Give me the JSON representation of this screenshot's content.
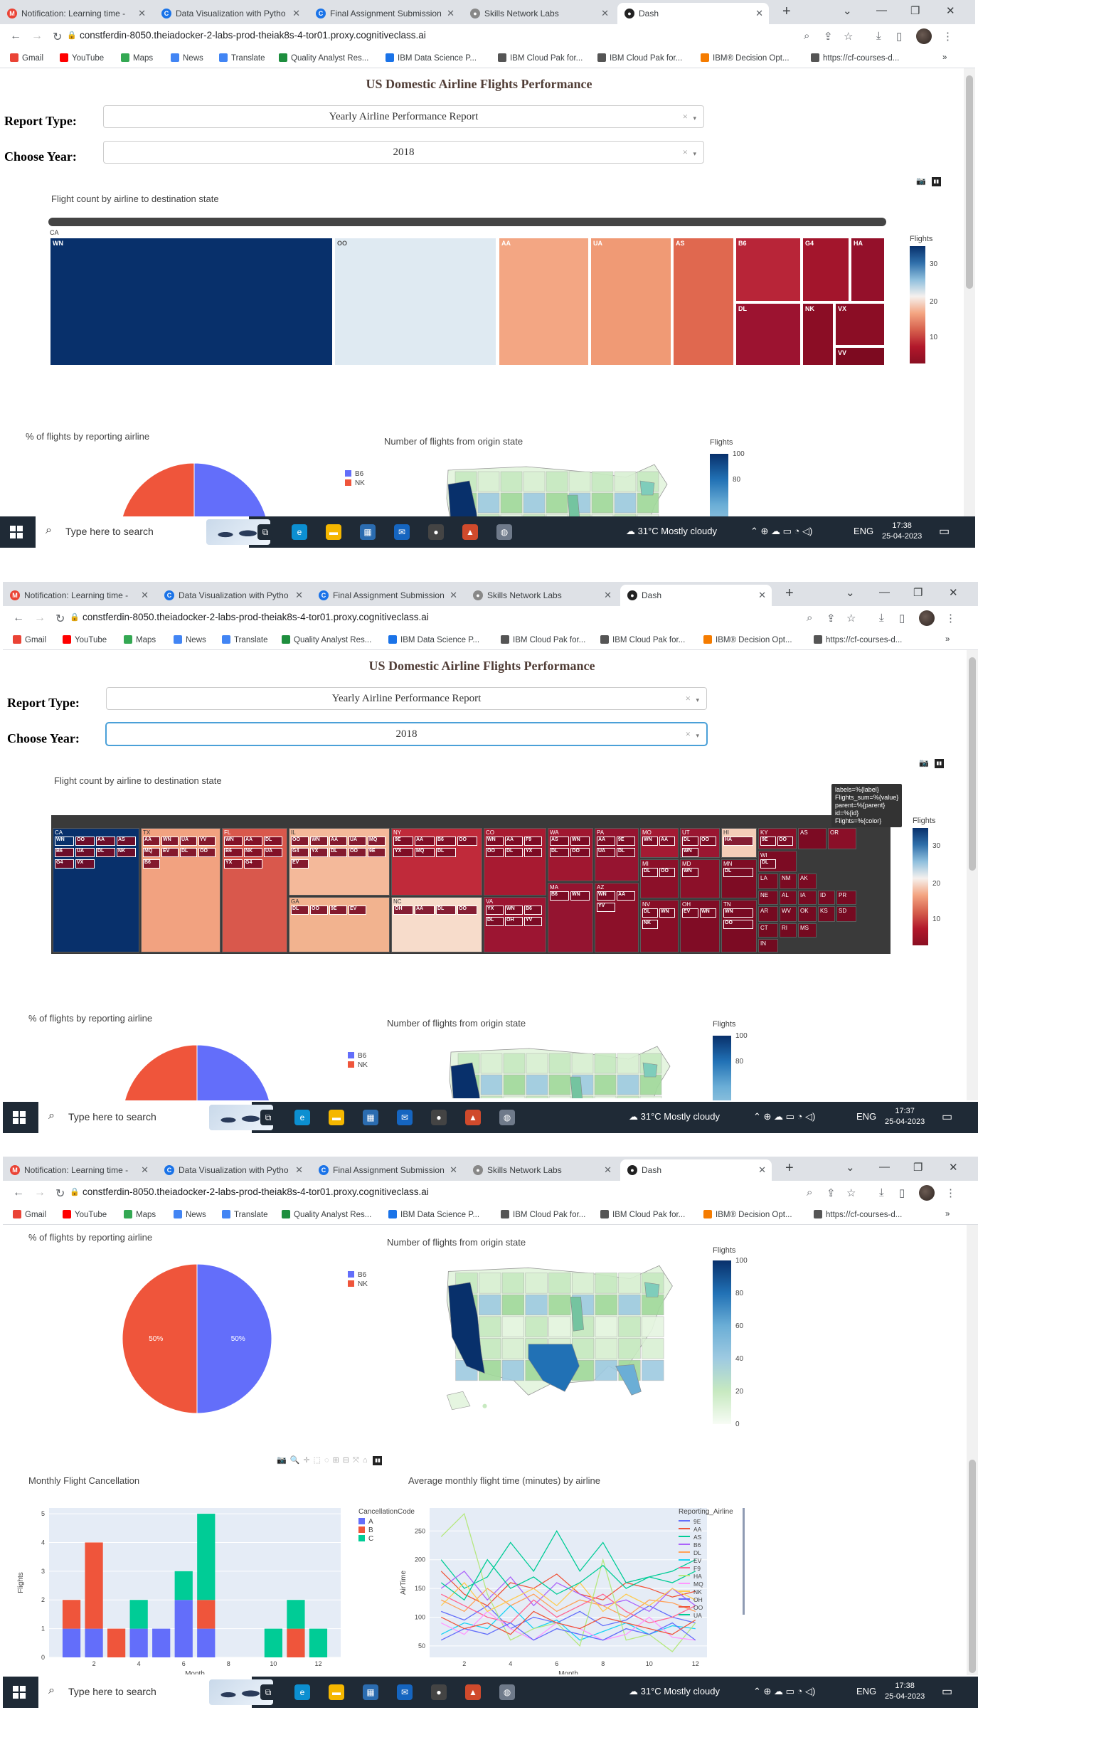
{
  "browser": {
    "tabs": [
      {
        "label": "Notification: Learning time - ",
        "favicon": "gmail-icon"
      },
      {
        "label": "Data Visualization with Pytho",
        "favicon": "coursera-icon"
      },
      {
        "label": "Final Assignment Submission",
        "favicon": "coursera-icon"
      },
      {
        "label": "Skills Network Labs",
        "favicon": "skills-network-icon"
      },
      {
        "label": "Dash",
        "favicon": "dash-icon"
      }
    ],
    "new_tab": "+",
    "url": "constferdin-8050.theiadocker-2-labs-prod-theiak8s-4-tor01.proxy.cognitiveclass.ai",
    "bookmarks": [
      "Gmail",
      "YouTube",
      "Maps",
      "News",
      "Translate",
      "Quality Analyst Res...",
      "IBM Data Science P...",
      "IBM Cloud Pak for...",
      "IBM Cloud Pak for...",
      "IBM® Decision Opt...",
      "https://cf-courses-d..."
    ],
    "more": "»"
  },
  "dashboard": {
    "title": "US Domestic Airline Flights Performance",
    "report_type_label": "Report Type:",
    "report_type_value": "Yearly Airline Performance Report",
    "year_label": "Choose Year:",
    "year_value": "2018",
    "clear": "×",
    "caret": "▾"
  },
  "treemap": {
    "title": "Flight count by airline to destination state",
    "colorbar_title": "Flights",
    "colorbar_ticks": [
      "30",
      "20",
      "10"
    ],
    "zoomed_parent": "CA",
    "zoomed_cells": [
      "WN",
      "OO",
      "AA",
      "UA",
      "AS",
      "B6",
      "G4",
      "HA",
      "DL",
      "NK",
      "VX",
      "VV"
    ],
    "states": [
      "CA",
      "TX",
      "FL",
      "IL",
      "NY",
      "CO",
      "WA",
      "PA",
      "MO",
      "UT",
      "HI",
      "KY",
      "GA",
      "NC",
      "VA",
      "MA",
      "AZ",
      "MI",
      "MD",
      "MN",
      "NV",
      "OH",
      "TN",
      "WI",
      "LA",
      "NM",
      "AK",
      "NE",
      "AL",
      "IA",
      "ID",
      "PR",
      "AR",
      "WV",
      "OK",
      "KS",
      "SD",
      "CT",
      "RI",
      "MS",
      "IN",
      "AS",
      "OR"
    ],
    "sub_labels": {
      "CA": [
        "WN",
        "OO",
        "AA",
        "AS",
        "B6",
        "UA",
        "DL",
        "NK",
        "G4",
        "VX"
      ],
      "TX": [
        "AA",
        "WN",
        "UA",
        "YV",
        "MQ",
        "EV",
        "DL",
        "OO",
        "B6"
      ],
      "FL": [
        "WN",
        "AA",
        "DL",
        "B6",
        "NK",
        "UA",
        "YX",
        "G4"
      ],
      "IL": [
        "OO",
        "WN",
        "AA",
        "UA",
        "MQ",
        "G4",
        "YX",
        "DL",
        "OO",
        "9E",
        "EV"
      ],
      "NY": [
        "9E",
        "AA",
        "B6",
        "OO",
        "YX",
        "MQ",
        "DL"
      ],
      "CO": [
        "WN",
        "AA",
        "F9",
        "OO",
        "DL",
        "YX"
      ],
      "WA": [
        "AS",
        "WN",
        "DL",
        "OO"
      ],
      "PA": [
        "AA",
        "9E",
        "UA",
        "DL"
      ],
      "MO": [
        "WN",
        "AA"
      ],
      "UT": [
        "DL",
        "OO",
        "WN"
      ],
      "HI": [
        "HA"
      ],
      "KY": [
        "9E",
        "OO",
        "DL"
      ],
      "GA": [
        "DL",
        "OO",
        "9E",
        "EV"
      ],
      "NC": [
        "OH",
        "AA",
        "DL",
        "OO"
      ],
      "VA": [
        "YX",
        "WN",
        "B6",
        "DL",
        "OH",
        "YV"
      ],
      "MA": [
        "B6",
        "WN"
      ],
      "AZ": [
        "WN",
        "AA",
        "YV"
      ],
      "MI": [
        "DL",
        "OO"
      ],
      "MD": [
        "WN"
      ],
      "MN": [
        "DL"
      ],
      "NV": [
        "DL",
        "WN",
        "NK"
      ],
      "OH": [
        "EV",
        "WN"
      ],
      "TN": [
        "WN",
        "OO"
      ],
      "WI": [
        "DL"
      ]
    }
  },
  "tooltip": {
    "lines": [
      "labels=%{label}",
      "Flights_sum=%{value}",
      "parent=%{parent}",
      "id=%{id}",
      "Flights=%{color}"
    ]
  },
  "pie": {
    "title": "% of flights by reporting airline",
    "legend": [
      {
        "label": "B6",
        "color": "#636efa"
      },
      {
        "label": "NK",
        "color": "#ef553b"
      }
    ],
    "slices": [
      {
        "label": "B6",
        "value": 50,
        "text": "50%"
      },
      {
        "label": "NK",
        "value": 50,
        "text": "50%"
      }
    ]
  },
  "map": {
    "title": "Number of flights from origin state",
    "colorbar_title": "Flights",
    "colorbar_ticks": [
      "100",
      "80",
      "60",
      "40",
      "20",
      "0"
    ]
  },
  "cancellation": {
    "title": "Monthly Flight Cancellation",
    "ylabel": "Flights",
    "xlabel": "Month",
    "legend_title": "CancellationCode",
    "legend": [
      {
        "label": "A",
        "color": "#636efa"
      },
      {
        "label": "B",
        "color": "#ef553b"
      },
      {
        "label": "C",
        "color": "#00cc96"
      }
    ],
    "y_ticks": [
      "0",
      "1",
      "2",
      "3",
      "4",
      "5"
    ],
    "x_ticks": [
      "2",
      "4",
      "6",
      "8",
      "10",
      "12"
    ]
  },
  "airtime": {
    "title": "Average monthly flight time (minutes) by airline",
    "ylabel": "AirTime",
    "xlabel": "Month",
    "legend_title": "Reporting_Airline",
    "y_ticks": [
      "50",
      "100",
      "150",
      "200",
      "250"
    ],
    "x_ticks": [
      "2",
      "4",
      "6",
      "8",
      "10",
      "12"
    ]
  },
  "taskbar": {
    "search_placeholder": "Type here to search",
    "weather": "31°C  Mostly cloudy",
    "lang": "ENG",
    "date": "25-04-2023",
    "times": [
      "17:38",
      "17:37",
      "17:38"
    ]
  },
  "chart_data": [
    {
      "type": "pie",
      "title": "% of flights by reporting airline",
      "labels": [
        "B6",
        "NK"
      ],
      "values": [
        50,
        50
      ],
      "colors": [
        "#636efa",
        "#ef553b"
      ]
    },
    {
      "type": "bar",
      "title": "Monthly Flight Cancellation",
      "xlabel": "Month",
      "ylabel": "Flights",
      "barmode": "stack",
      "x": [
        1,
        2,
        3,
        4,
        5,
        6,
        7,
        10,
        11,
        12
      ],
      "series": [
        {
          "name": "A",
          "color": "#636efa",
          "values": [
            1,
            1,
            0,
            1,
            1,
            2,
            1,
            0,
            0,
            0
          ]
        },
        {
          "name": "B",
          "color": "#ef553b",
          "values": [
            1,
            3,
            1,
            0,
            0,
            0,
            1,
            0,
            1,
            0
          ]
        },
        {
          "name": "C",
          "color": "#00cc96",
          "values": [
            0,
            0,
            0,
            1,
            0,
            1,
            3,
            1,
            1,
            1
          ]
        }
      ],
      "ylim": [
        0,
        5.2
      ],
      "xlim": [
        0,
        13
      ]
    },
    {
      "type": "line",
      "title": "Average monthly flight time (minutes) by airline",
      "xlabel": "Month",
      "ylabel": "AirTime",
      "x": [
        1,
        2,
        3,
        4,
        5,
        6,
        7,
        8,
        9,
        10,
        11,
        12
      ],
      "ylim": [
        30,
        290
      ],
      "series": [
        {
          "name": "9E",
          "color": "#636efa",
          "values": [
            110,
            95,
            120,
            80,
            100,
            90,
            110,
            85,
            95,
            120,
            100,
            90
          ]
        },
        {
          "name": "AA",
          "color": "#ef553b",
          "values": [
            180,
            140,
            120,
            160,
            150,
            175,
            140,
            130,
            160,
            150,
            135,
            145
          ]
        },
        {
          "name": "AS",
          "color": "#00cc96",
          "values": [
            200,
            150,
            170,
            230,
            180,
            250,
            180,
            230,
            160,
            170,
            180,
            200
          ]
        },
        {
          "name": "B6",
          "color": "#ab63fa",
          "values": [
            150,
            180,
            130,
            170,
            120,
            160,
            140,
            120,
            130,
            110,
            150,
            120
          ]
        },
        {
          "name": "DL",
          "color": "#ffa15a",
          "values": [
            130,
            110,
            150,
            120,
            140,
            110,
            130,
            120,
            100,
            130,
            125,
            110
          ]
        },
        {
          "name": "EV",
          "color": "#19d3f3",
          "values": [
            70,
            90,
            80,
            120,
            80,
            95,
            60,
            75,
            90,
            70,
            85,
            80
          ]
        },
        {
          "name": "F9",
          "color": "#ff6692",
          "values": [
            140,
            120,
            100,
            90,
            130,
            100,
            120,
            140,
            110,
            90,
            100,
            120
          ]
        },
        {
          "name": "HA",
          "color": "#b6e880",
          "values": [
            240,
            280,
            140,
            60,
            80,
            90,
            50,
            200,
            60,
            70,
            40,
            90
          ]
        },
        {
          "name": "MQ",
          "color": "#ff97ff",
          "values": [
            90,
            70,
            110,
            80,
            60,
            90,
            80,
            60,
            70,
            100,
            65,
            60
          ]
        },
        {
          "name": "NK",
          "color": "#fecb52",
          "values": [
            120,
            160,
            110,
            130,
            150,
            120,
            160,
            110,
            140,
            120,
            150,
            130
          ]
        },
        {
          "name": "OH",
          "color": "#636efa",
          "values": [
            60,
            80,
            70,
            90,
            60,
            80,
            70,
            60,
            80,
            70,
            90,
            60
          ]
        },
        {
          "name": "OO",
          "color": "#ef553b",
          "values": [
            100,
            80,
            90,
            70,
            110,
            90,
            80,
            100,
            90,
            80,
            70,
            95
          ]
        },
        {
          "name": "UA",
          "color": "#00cc96",
          "values": [
            160,
            130,
            200,
            150,
            170,
            140,
            160,
            190,
            150,
            170,
            160,
            180
          ]
        }
      ]
    }
  ]
}
